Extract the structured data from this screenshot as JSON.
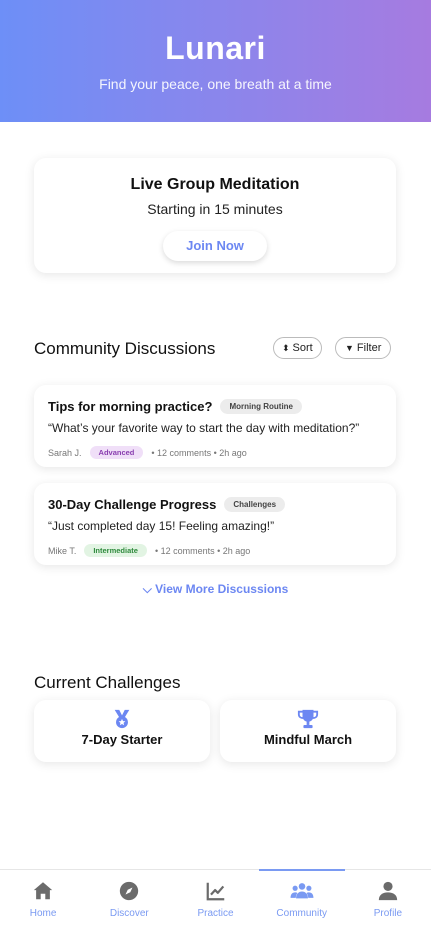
{
  "header": {
    "title": "Lunari",
    "tagline": "Find your peace, one breath at a time"
  },
  "live": {
    "title": "Live Group Meditation",
    "subtitle": "Starting in 15 minutes",
    "join_label": "Join Now"
  },
  "discussions": {
    "section_title": "Community Discussions",
    "sort_label": "Sort",
    "filter_label": "Filter",
    "items": [
      {
        "title": "Tips for morning practice?",
        "tag": "Morning Routine",
        "quote": "“What’s your favorite way to start the day with meditation?”",
        "author": "Sarah J.",
        "level": "Advanced",
        "meta": "• 12 comments • 2h ago"
      },
      {
        "title": "30-Day Challenge Progress",
        "tag": "Challenges",
        "quote": "“Just completed day 15! Feeling amazing!”",
        "author": "Mike T.",
        "level": "Intermediate",
        "meta": "• 12 comments • 2h ago"
      }
    ],
    "view_more": "View More Discussions"
  },
  "challenges": {
    "section_title": "Current Challenges",
    "items": [
      {
        "name": "7-Day Starter",
        "icon": "medal-icon"
      },
      {
        "name": "Mindful March",
        "icon": "trophy-icon"
      }
    ]
  },
  "nav": {
    "items": [
      {
        "label": "Home",
        "icon": "home-icon"
      },
      {
        "label": "Discover",
        "icon": "compass-icon"
      },
      {
        "label": "Practice",
        "icon": "chart-icon"
      },
      {
        "label": "Community",
        "icon": "users-icon",
        "active": true
      },
      {
        "label": "Profile",
        "icon": "profile-icon"
      }
    ]
  },
  "colors": {
    "accent": "#6c87f2",
    "gradient_start": "#6d8ff7",
    "gradient_end": "#a67be0",
    "nav_icon": "#6b6b6b"
  }
}
